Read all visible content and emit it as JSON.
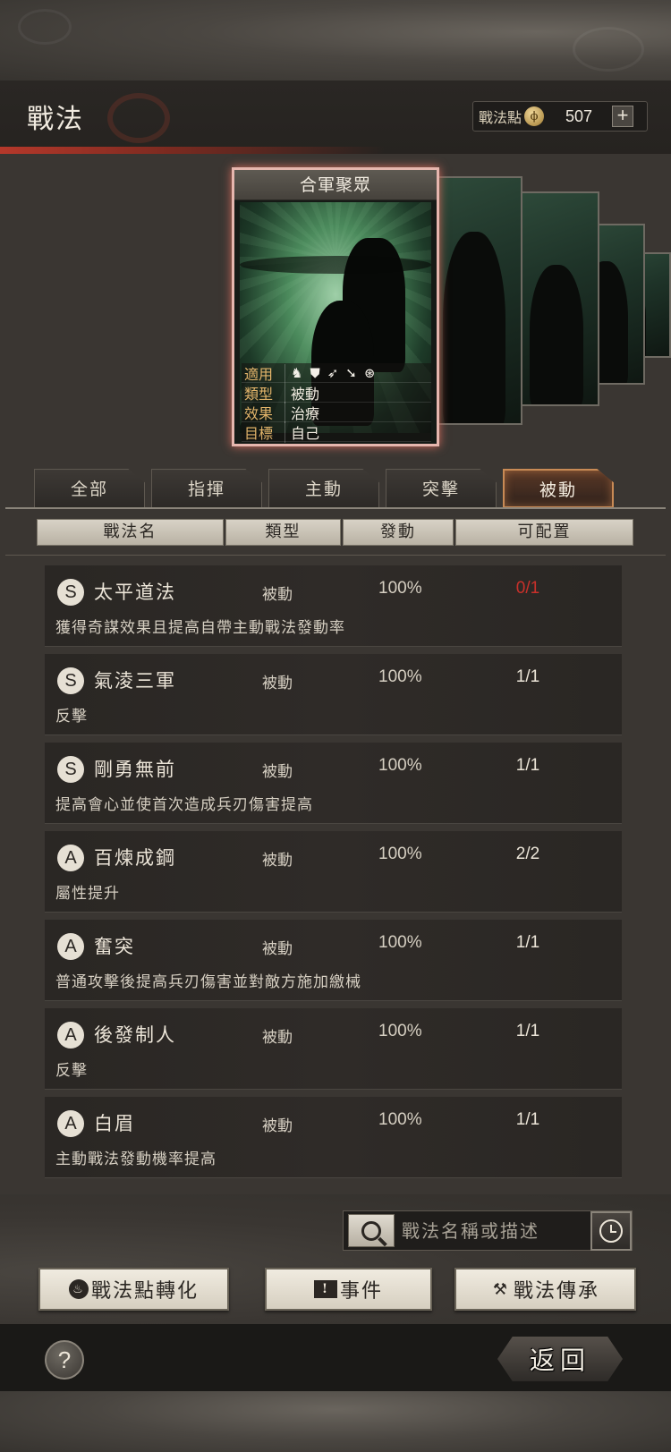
{
  "header": {
    "title": "戰法",
    "points_label": "戰法點",
    "points_value": "507",
    "add_label": "+"
  },
  "card": {
    "name": "合軍聚眾",
    "stats": [
      {
        "label": "適用"
      },
      {
        "label": "類型",
        "value": "被動"
      },
      {
        "label": "效果",
        "value": "治療"
      },
      {
        "label": "目標",
        "value": "自己"
      }
    ],
    "troop_icons": [
      "cavalry-icon",
      "shield-icon",
      "bow-icon",
      "spear-icon",
      "siege-icon"
    ]
  },
  "tabs": [
    {
      "label": "全部",
      "active": false
    },
    {
      "label": "指揮",
      "active": false
    },
    {
      "label": "主動",
      "active": false
    },
    {
      "label": "突擊",
      "active": false
    },
    {
      "label": "被動",
      "active": true
    }
  ],
  "columns": [
    "戰法名",
    "類型",
    "發動",
    "可配置"
  ],
  "skills": [
    {
      "grade": "S",
      "name": "太平道法",
      "type": "被動",
      "rate": "100%",
      "slots": "0/1",
      "slots_full": true,
      "desc": "獲得奇謀效果且提高自帶主動戰法發動率"
    },
    {
      "grade": "S",
      "name": "氣淩三軍",
      "type": "被動",
      "rate": "100%",
      "slots": "1/1",
      "slots_full": false,
      "desc": "反擊"
    },
    {
      "grade": "S",
      "name": "剛勇無前",
      "type": "被動",
      "rate": "100%",
      "slots": "1/1",
      "slots_full": false,
      "desc": "提高會心並使首次造成兵刃傷害提高"
    },
    {
      "grade": "A",
      "name": "百煉成鋼",
      "type": "被動",
      "rate": "100%",
      "slots": "2/2",
      "slots_full": false,
      "desc": "屬性提升"
    },
    {
      "grade": "A",
      "name": "奮突",
      "type": "被動",
      "rate": "100%",
      "slots": "1/1",
      "slots_full": false,
      "desc": "普通攻擊後提高兵刃傷害並對敵方施加繳械"
    },
    {
      "grade": "A",
      "name": "後發制人",
      "type": "被動",
      "rate": "100%",
      "slots": "1/1",
      "slots_full": false,
      "desc": "反擊"
    },
    {
      "grade": "A",
      "name": "白眉",
      "type": "被動",
      "rate": "100%",
      "slots": "1/1",
      "slots_full": false,
      "desc": "主動戰法發動機率提高"
    }
  ],
  "search": {
    "placeholder": "戰法名稱或描述"
  },
  "buttons": {
    "convert": "戰法點轉化",
    "event": "事件",
    "inherit": "戰法傳承",
    "help": "?",
    "back": "返回"
  },
  "colors": {
    "slot_full": "#c9302a",
    "active_tab_border": "#c88a55",
    "card_border": "#e6b6ae"
  }
}
